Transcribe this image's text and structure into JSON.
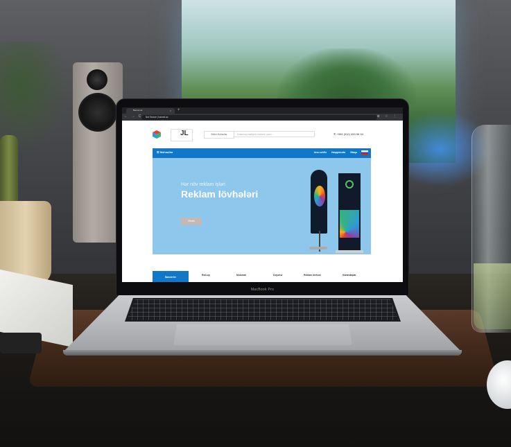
{
  "browser": {
    "tab_title": "Bannet.az",
    "tab_close": "×",
    "new_tab": "+",
    "nav_icons": "← → C",
    "url": "Not Secure | bannet.az",
    "extension_icons": "⊕ ☆ ⋮"
  },
  "site": {
    "category_select": "Bütün Məhsullar",
    "search_placeholder": "Axtarmaq istədiyiniz məhsulu yazın...",
    "phone": "+994 (012) 493 56 34",
    "logo_letters": "JL",
    "nav": {
      "menu_label": "Məhsullar",
      "links": [
        "Ana səhifə",
        "Haqqımızda",
        "Əlaqə"
      ]
    },
    "hero": {
      "subtitle": "Hər növ reklam işləri",
      "title": "Reklam lövhələri",
      "button": "Ətraflı"
    },
    "category_tabs": [
      "Bannerler",
      "Roll-up",
      "Məlumat",
      "Dəyərlər",
      "Reklam lövhəsi",
      "Karandaşlar"
    ]
  },
  "laptop": {
    "brand": "MacBook Pro"
  },
  "colors": {
    "accent": "#1177c8",
    "hero_bg": "#8ec7ec"
  }
}
